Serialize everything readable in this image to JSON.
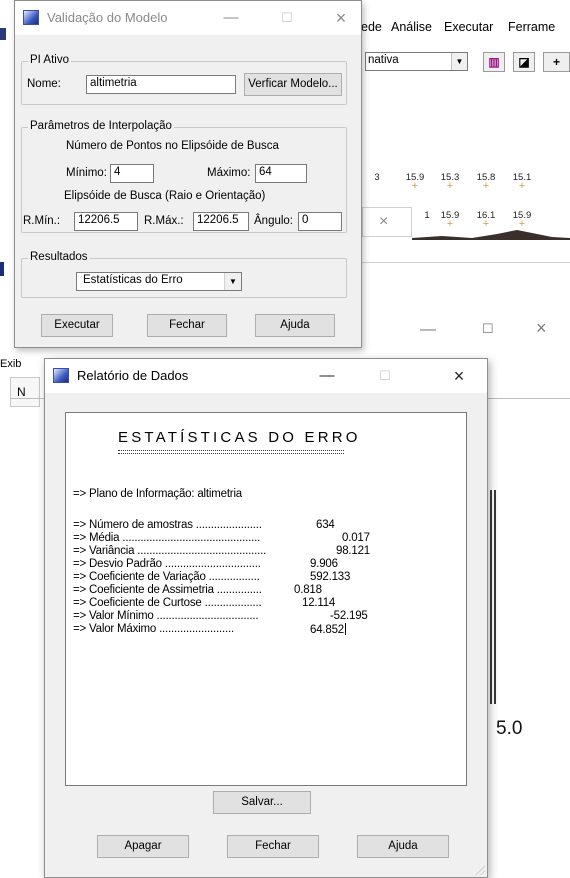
{
  "background_app": {
    "menu": [
      "ede",
      "Análise",
      "Executar",
      "Ferrame"
    ],
    "left_menu_fragment": "Exib",
    "left_letter": "N",
    "toolbar_combo_value": "nativa",
    "grid_row1": [
      "15.9",
      "15.3",
      "15.8",
      "15.1"
    ],
    "grid_row1_prefix": "3",
    "grid_row2": [
      "1",
      "15.9",
      "16.1",
      "15.9"
    ],
    "graph_value": "5.0"
  },
  "validation_dialog": {
    "title": "Validação do Modelo",
    "pi_group": "PI Ativo",
    "name_label": "Nome:",
    "name_value": "altimetria",
    "verify_button": "Verficar Modelo...",
    "interp_group": "Parâmetros de Interpolação",
    "points_caption": "Número de Pontos no Elipsóide de Busca",
    "min_label": "Mínimo:",
    "min_value": "4",
    "max_label": "Máximo:",
    "max_value": "64",
    "ellipsoid_caption": "Elipsóide de Busca (Raio e Orientação)",
    "rmin_label": "R.Mín.:",
    "rmin_value": "12206.5",
    "rmax_label": "R.Máx.:",
    "rmax_value": "12206.5",
    "angle_label": "Ângulo:",
    "angle_value": "0",
    "results_group": "Resultados",
    "results_selected": "Estatísticas do Erro",
    "execute_button": "Executar",
    "close_button": "Fechar",
    "help_button": "Ajuda"
  },
  "report_dialog": {
    "title": "Relatório de Dados",
    "heading": "ESTATÍSTICAS DO ERRO",
    "plan_line": "=> Plano de Informação: altimetria",
    "stats": [
      {
        "label": "=> Número de amostras ......................",
        "value": "634"
      },
      {
        "label": "=> Média ..............................................",
        "value": "0.017"
      },
      {
        "label": "=> Variância ...........................................",
        "value": "98.121"
      },
      {
        "label": "=> Desvio Padrão ................................",
        "value": "9.906"
      },
      {
        "label": "=> Coeficiente de Variação .................",
        "value": "592.133"
      },
      {
        "label": "=> Coeficiente de Assimetria ...............",
        "value": "0.818"
      },
      {
        "label": "=> Coeficiente de Curtose ...................",
        "value": "12.114"
      },
      {
        "label": "=> Valor Mínimo ..................................",
        "value": "-52.195"
      },
      {
        "label": "=> Valor Máximo .........................",
        "value": "64.852"
      }
    ],
    "save_button": "Salvar...",
    "clear_button": "Apagar",
    "close_button": "Fechar",
    "help_button": "Ajuda"
  }
}
